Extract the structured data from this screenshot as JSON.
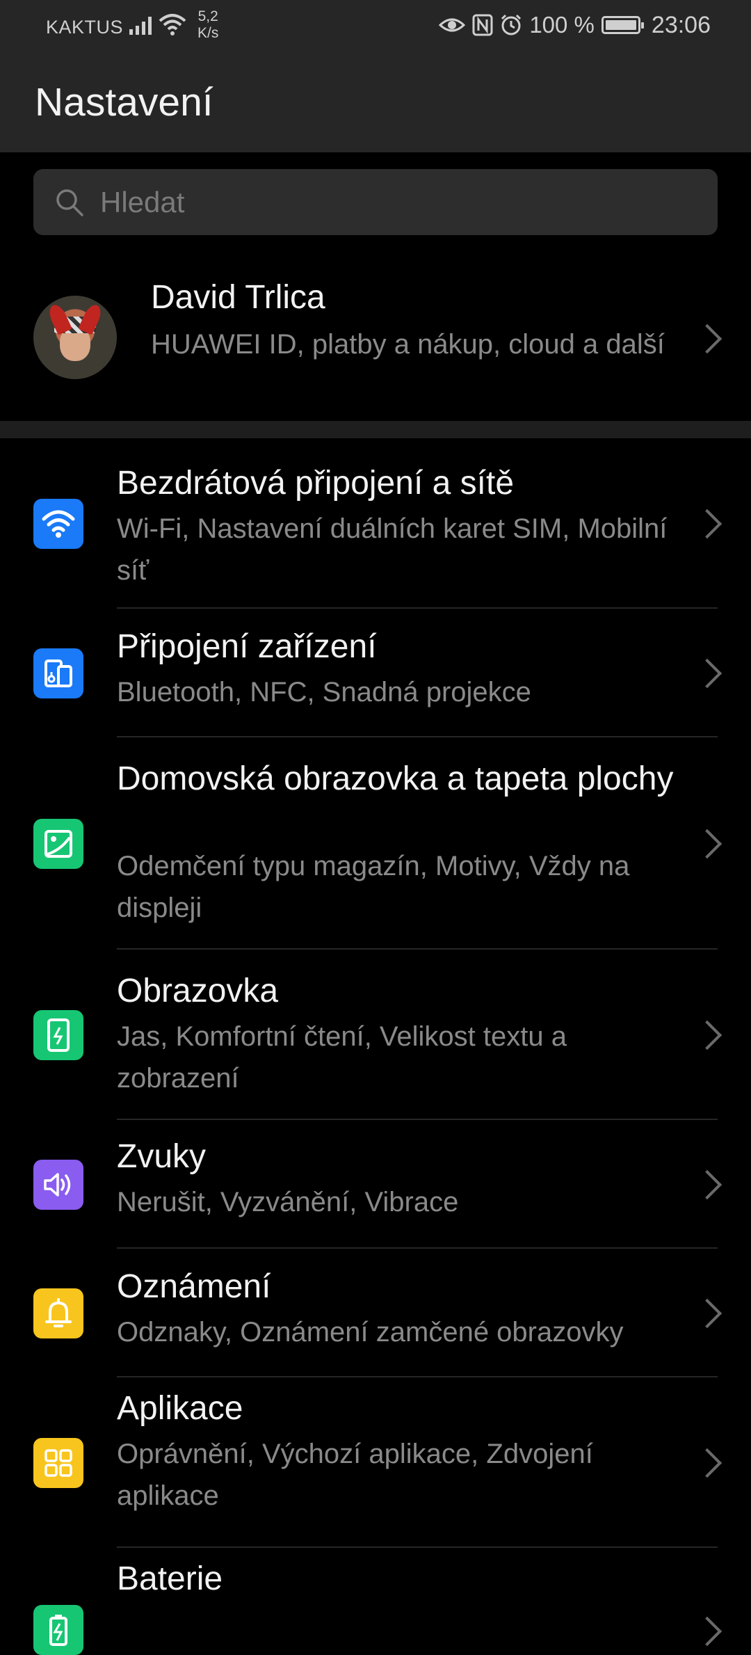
{
  "status_bar": {
    "carrier": "KAKTUS",
    "speed_value": "5,2",
    "speed_unit": "K/s",
    "battery_pct": "100 %",
    "time": "23:06"
  },
  "header": {
    "title": "Nastavení"
  },
  "search": {
    "placeholder": "Hledat"
  },
  "profile": {
    "name": "David Trlica",
    "subtitle": "HUAWEI ID, platby a nákup, cloud a další"
  },
  "items": [
    {
      "title": "Bezdrátová připojení a sítě",
      "subtitle": "Wi-Fi, Nastavení duálních karet SIM, Mobilní síť",
      "icon": "wifi-icon",
      "color": "#1a7af8"
    },
    {
      "title": "Připojení zařízení",
      "subtitle": "Bluetooth, NFC, Snadná projekce",
      "icon": "device-connection-icon",
      "color": "#1a7af8"
    },
    {
      "title": "Domovská obrazovka a tapeta plochy",
      "subtitle": "Odemčení typu magazín, Motivy, Vždy na displeji",
      "icon": "wallpaper-icon",
      "color": "#17c673"
    },
    {
      "title": "Obrazovka",
      "subtitle": "Jas, Komfortní čtení, Velikost textu a zobrazení",
      "icon": "display-icon",
      "color": "#17c673"
    },
    {
      "title": "Zvuky",
      "subtitle": "Nerušit, Vyzvánění, Vibrace",
      "icon": "speaker-icon",
      "color": "#8a5cf0"
    },
    {
      "title": "Oznámení",
      "subtitle": "Odznaky, Oznámení zamčené obrazovky",
      "icon": "bell-icon",
      "color": "#f8c51e"
    },
    {
      "title": "Aplikace",
      "subtitle": "Oprávnění, Výchozí aplikace, Zdvojení aplikace",
      "icon": "apps-grid-icon",
      "color": "#f8c51e"
    },
    {
      "title": "Baterie",
      "subtitle": "",
      "icon": "battery-icon",
      "color": "#17c673"
    }
  ]
}
